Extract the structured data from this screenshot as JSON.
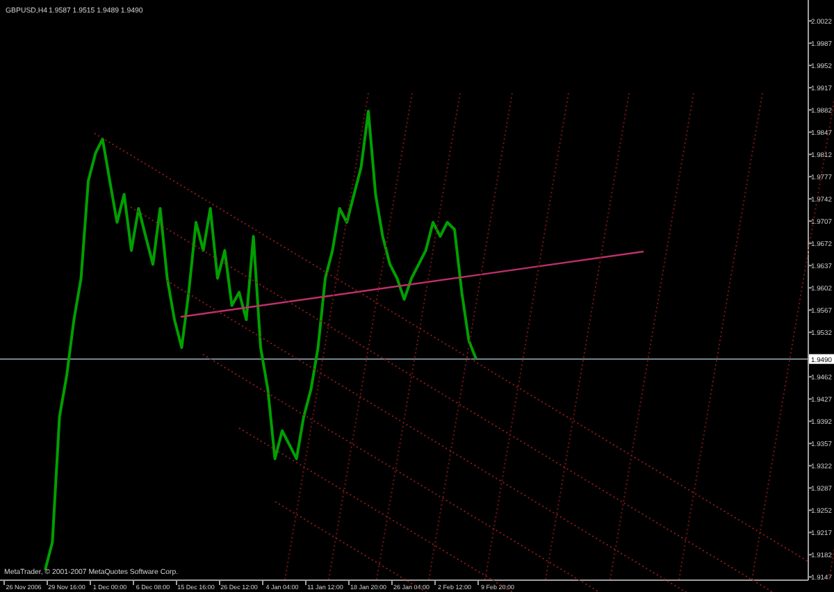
{
  "chart": {
    "chart_data": {
      "type": "line",
      "categories": [
        "26 Nov 2006",
        null,
        null,
        null,
        null,
        null,
        "29 Nov 16:00",
        null,
        null,
        null,
        null,
        null,
        "1 Dec 00:00",
        null,
        null,
        null,
        null,
        null,
        "6 Dec 08:00",
        null,
        null,
        null,
        null,
        null,
        "15 Dec 16:00",
        null,
        null,
        null,
        null,
        null,
        "26 Dec 12:00",
        null,
        null,
        null,
        null,
        null,
        "4 Jan 04:00",
        null,
        null,
        null,
        null,
        null,
        "11 Jan 12:00",
        null,
        null,
        null,
        null,
        null,
        "18 Jan 20:00",
        null,
        null,
        null,
        null,
        null,
        "26 Jan 04:00",
        null,
        null,
        null,
        null,
        null,
        "2 Feb 12:00",
        null,
        null,
        null,
        null,
        null,
        "9 Feb 20:00"
      ],
      "series": [
        {
          "name": "GBPUSD,H4",
          "color": "#00a000",
          "values": [
            null,
            null,
            null,
            1.9158,
            1.9202,
            1.9399,
            1.9464,
            1.9552,
            1.9617,
            1.977,
            1.9814,
            1.9836,
            1.977,
            1.9705,
            1.9749,
            1.9661,
            1.9727,
            1.9683,
            1.9639,
            1.9727,
            1.9617,
            1.9552,
            1.9508,
            1.9595,
            1.9705,
            1.9661,
            1.9727,
            1.9617,
            1.9661,
            1.9574,
            1.9595,
            1.9552,
            1.9683,
            1.9508,
            1.9442,
            1.9333,
            1.9377,
            1.9355,
            1.9333,
            1.9399,
            1.9442,
            1.9508,
            1.9617,
            1.9661,
            1.9727,
            1.9705,
            1.9749,
            1.9792,
            1.988,
            1.9749,
            1.9683,
            1.9639,
            1.9617,
            1.9584,
            1.9617,
            1.9639,
            1.9661,
            1.9705,
            1.9683,
            1.9705,
            1.9694,
            1.9595,
            1.9519,
            1.949,
            null,
            null,
            null
          ]
        }
      ],
      "ref_lines": [
        {
          "axis": "y",
          "value": 1.949,
          "color": "#7d8b99"
        }
      ],
      "ylim": [
        1.9143,
        2.0055
      ],
      "yticks": [
        {
          "value": 2.0022,
          "label": "2.0022"
        },
        {
          "value": 1.9987,
          "label": "1.9987"
        },
        {
          "value": 1.9952,
          "label": "1.9952"
        },
        {
          "value": 1.9917,
          "label": "1.9917"
        },
        {
          "value": 1.9882,
          "label": "1.9882"
        },
        {
          "value": 1.9847,
          "label": "1.9847"
        },
        {
          "value": 1.9812,
          "label": "1.9812"
        },
        {
          "value": 1.9777,
          "label": "1.9777"
        },
        {
          "value": 1.9742,
          "label": "1.9742"
        },
        {
          "value": 1.9707,
          "label": "1.9707"
        },
        {
          "value": 1.9672,
          "label": "1.9672"
        },
        {
          "value": 1.9637,
          "label": "1.9637"
        },
        {
          "value": 1.9602,
          "label": "1.9602"
        },
        {
          "value": 1.9567,
          "label": "1.9567"
        },
        {
          "value": 1.9532,
          "label": "1.9532"
        },
        {
          "value": 1.9462,
          "label": "1.9462"
        },
        {
          "value": 1.9427,
          "label": "1.9427"
        },
        {
          "value": 1.9392,
          "label": "1.9392"
        },
        {
          "value": 1.9357,
          "label": "1.9357"
        },
        {
          "value": 1.9322,
          "label": "1.9322"
        },
        {
          "value": 1.9287,
          "label": "1.9287"
        },
        {
          "value": 1.9252,
          "label": "1.9252"
        },
        {
          "value": 1.9217,
          "label": "1.9217"
        },
        {
          "value": 1.9182,
          "label": "1.9182"
        },
        {
          "value": 1.9147,
          "label": "1.9147"
        }
      ]
    },
    "drawings": [
      {
        "kind": "trend_line"
      },
      {
        "kind": "fibonacci_grid"
      }
    ],
    "quote": "1.9587 1.9515 1.9489 1.9490",
    "current_price": "1.9490",
    "copyright": "MetaTrader, © 2001-2007 MetaQuotes Software Corp."
  }
}
